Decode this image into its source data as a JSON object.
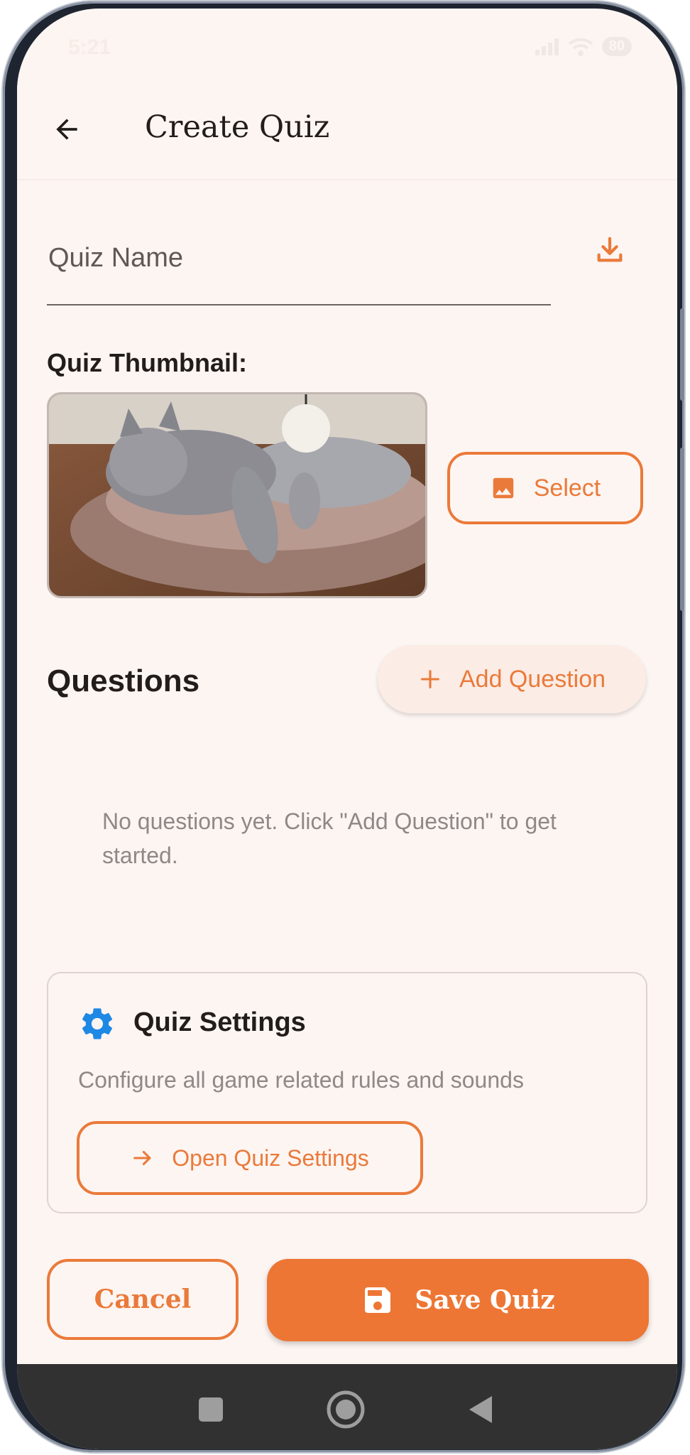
{
  "status_bar": {
    "time": "5:21",
    "battery": "80"
  },
  "app_bar": {
    "title": "Create Quiz"
  },
  "form": {
    "quiz_name_placeholder": "Quiz Name",
    "quiz_name_value": "",
    "thumbnail_label": "Quiz Thumbnail:",
    "select_label": "Select"
  },
  "questions": {
    "title": "Questions",
    "add_label": "Add Question",
    "empty_message": "No questions yet. Click \"Add Question\" to get started."
  },
  "settings_card": {
    "title": "Quiz Settings",
    "description": "Configure all game related rules and sounds",
    "open_label": "Open Quiz Settings"
  },
  "actions": {
    "cancel_label": "Cancel",
    "save_label": "Save Quiz"
  },
  "icons": {
    "back": "arrow-back-icon",
    "download": "download-icon",
    "image": "image-icon",
    "add": "plus-icon",
    "settings": "gear-icon",
    "open": "arrow-forward-icon",
    "save": "save-icon"
  },
  "colors": {
    "accent": "#ea7a3a",
    "save_fill": "#ee7634",
    "background": "#fdf5f2",
    "settings_icon": "#1e88e5"
  }
}
